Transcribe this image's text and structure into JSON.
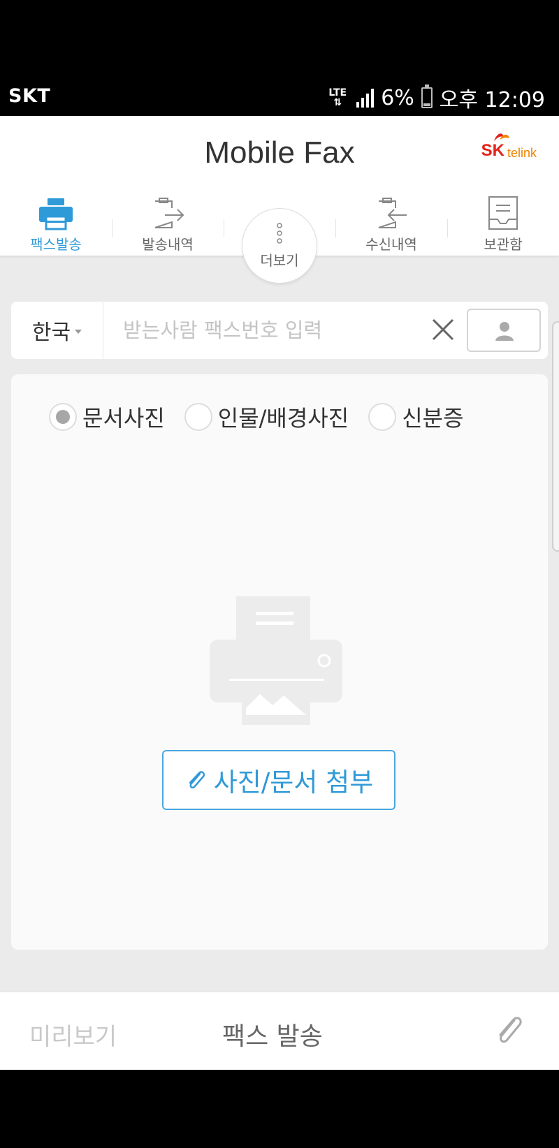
{
  "status_bar": {
    "carrier": "SKT",
    "network": "LTE",
    "battery": "6%",
    "time": "오후 12:09"
  },
  "header": {
    "title": "Mobile Fax",
    "logo_mark": "SK",
    "logo_sub": "telink"
  },
  "tabs": [
    {
      "label": "팩스발송",
      "icon": "fax-printer-icon",
      "active": true
    },
    {
      "label": "발송내역",
      "icon": "sent-history-icon",
      "active": false
    },
    {
      "label": "더보기",
      "icon": "more-dots-icon",
      "active": false
    },
    {
      "label": "수신내역",
      "icon": "received-history-icon",
      "active": false
    },
    {
      "label": "보관함",
      "icon": "archive-icon",
      "active": false
    }
  ],
  "recipient": {
    "country": "한국",
    "placeholder": "받는사람 팩스번호 입력",
    "value": ""
  },
  "document_type": {
    "options": [
      "문서사진",
      "인물/배경사진",
      "신분증"
    ],
    "selected": "문서사진"
  },
  "attach": {
    "label": "사진/문서 첨부"
  },
  "bottom_bar": {
    "preview_label": "미리보기",
    "send_label": "팩스 발송"
  },
  "colors": {
    "accent": "#2f9ad8",
    "logo_red": "#e2231a",
    "logo_orange": "#f08300"
  }
}
